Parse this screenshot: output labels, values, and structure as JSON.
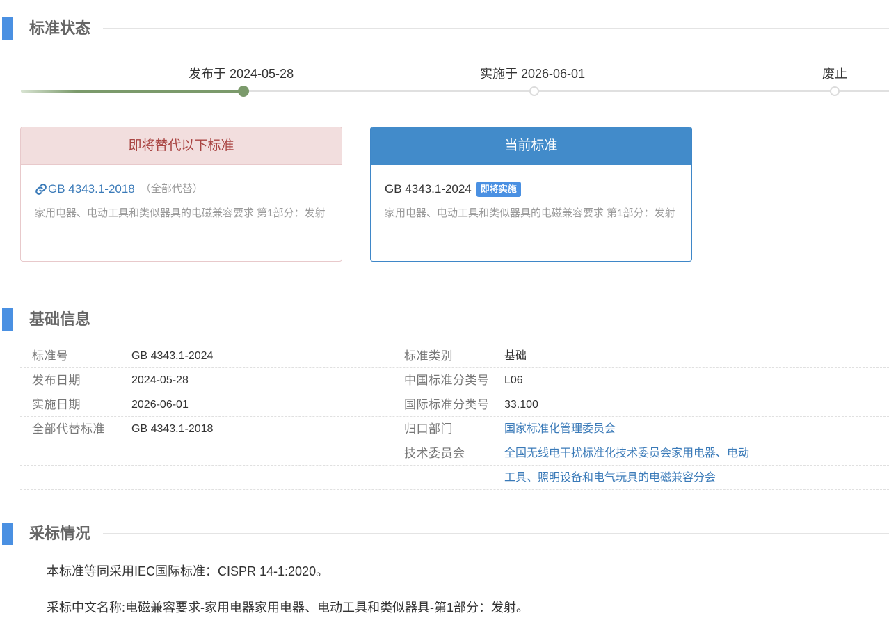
{
  "status_section": {
    "title": "标准状态"
  },
  "timeline": {
    "published_label": "发布于 2024-05-28",
    "implemented_label": "实施于 2026-06-01",
    "abolished_label": "废止"
  },
  "replace_card": {
    "header": "即将替代以下标准",
    "standard_code": "GB 4343.1-2018",
    "note": "（全部代替）",
    "description": "家用电器、电动工具和类似器具的电磁兼容要求 第1部分：发射",
    "icon": "link-icon"
  },
  "current_card": {
    "header": "当前标准",
    "standard_code": "GB 4343.1-2024",
    "badge": "即将实施",
    "description": "家用电器、电动工具和类似器具的电磁兼容要求 第1部分：发射"
  },
  "basic_section": {
    "title": "基础信息"
  },
  "basic_info": {
    "left": [
      {
        "label": "标准号",
        "value": "GB 4343.1-2024"
      },
      {
        "label": "发布日期",
        "value": "2024-05-28"
      },
      {
        "label": "实施日期",
        "value": "2026-06-01"
      },
      {
        "label": "全部代替标准",
        "value": "GB 4343.1-2018"
      }
    ],
    "right": [
      {
        "label": "标准类别",
        "value": "基础"
      },
      {
        "label": "中国标准分类号",
        "value": "L06"
      },
      {
        "label": "国际标准分类号",
        "value": "33.100"
      },
      {
        "label": "归口部门",
        "value": "国家标准化管理委员会"
      },
      {
        "label": "技术委员会",
        "value": "全国无线电干扰标准化技术委员会家用电器、电动",
        "value_cont": "工具、照明设备和电气玩具的电磁兼容分会"
      }
    ]
  },
  "adopt_section": {
    "title": "采标情况",
    "line1": "本标准等同采用IEC国际标准：CISPR 14-1:2020。",
    "line2": "采标中文名称:电磁兼容要求-家用电器家用电器、电动工具和类似器具-第1部分：发射。"
  },
  "colors": {
    "accent": "#4a90e2",
    "timeline_active": "#7b9a6b",
    "danger_bg": "#f2dede",
    "danger_text": "#a94442",
    "link": "#3a7ab8"
  }
}
